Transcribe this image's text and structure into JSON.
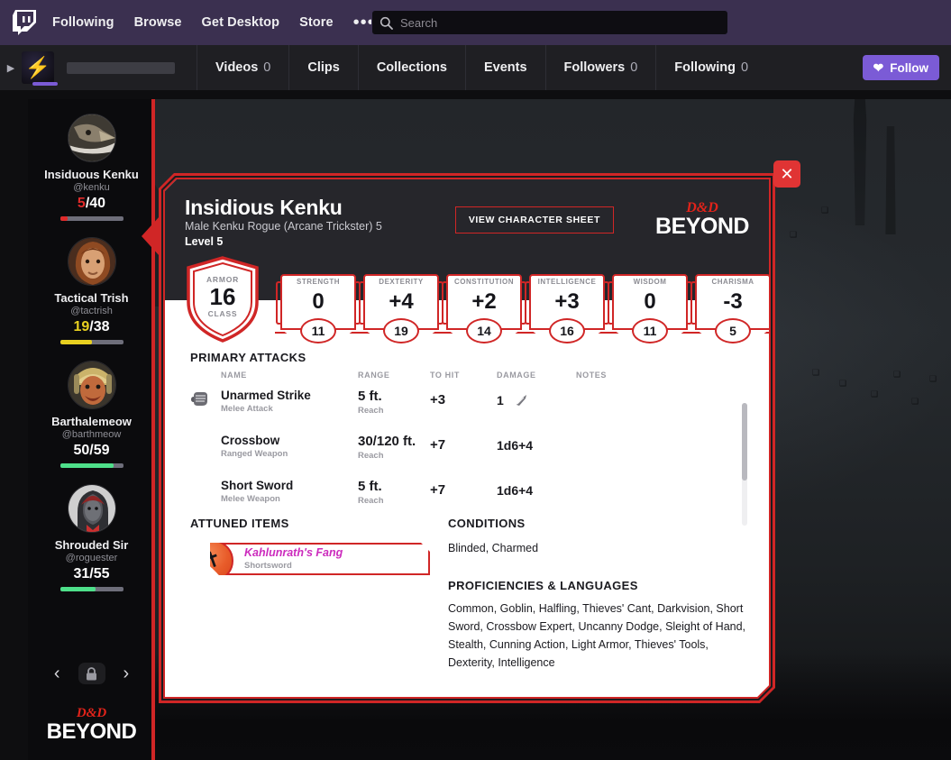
{
  "twitch": {
    "logo_icon": "twitch-logo-icon",
    "nav": [
      {
        "label": "Following"
      },
      {
        "label": "Browse"
      },
      {
        "label": "Get Desktop"
      },
      {
        "label": "Store"
      }
    ],
    "more_label": "•••",
    "search": {
      "icon": "search-icon",
      "value": "",
      "placeholder": "Search"
    },
    "channel": {
      "expand_icon": "chevron-right-icon",
      "avatar_icon": "lightning-bolt-icon",
      "name_placeholder": "",
      "tabs": [
        {
          "label": "Videos",
          "count": "0"
        },
        {
          "label": "Clips",
          "count": ""
        },
        {
          "label": "Collections",
          "count": ""
        },
        {
          "label": "Events",
          "count": ""
        },
        {
          "label": "Followers",
          "count": "0"
        },
        {
          "label": "Following",
          "count": "0"
        }
      ],
      "follow_label": "Follow",
      "follow_icon": "heart-icon",
      "follow_color": "#7b5bd6"
    }
  },
  "party": {
    "members": [
      {
        "name": "Insiduous Kenku",
        "handle": "@kenku",
        "hp_current": "5",
        "hp_max": "40",
        "hp_separator": "/",
        "hp_percent": 12,
        "hp_color": "#e02a2a",
        "avatar_icon": "kenku-portrait-avatar"
      },
      {
        "name": "Tactical Trish",
        "handle": "@tactrish",
        "hp_current": "19",
        "hp_max": "38",
        "hp_separator": "/",
        "hp_percent": 50,
        "hp_color": "#e8d020",
        "avatar_icon": "trish-portrait-avatar"
      },
      {
        "name": "Barthalemeow",
        "handle": "@barthmeow",
        "hp_current": "50",
        "hp_max": "59",
        "hp_separator": "/",
        "hp_percent": 85,
        "hp_color": "#4ee08a",
        "avatar_icon": "barthalemeow-portrait-avatar"
      },
      {
        "name": "Shrouded Sir",
        "handle": "@roguester",
        "hp_current": "31",
        "hp_max": "55",
        "hp_separator": "/",
        "hp_percent": 56,
        "hp_color": "#4ee08a",
        "avatar_icon": "shrouded-sir-portrait-avatar"
      }
    ],
    "prev_label": "‹",
    "next_label": "›",
    "lock_icon": "lock-icon",
    "logo": {
      "line1": "D&D",
      "line2": "BEYOND"
    }
  },
  "card": {
    "close_label": "✕",
    "name": "Insidious Kenku",
    "subtitle": "Male Kenku Rogue (Arcane Trickster) 5",
    "level": "Level 5",
    "view_sheet_label": "VIEW CHARACTER SHEET",
    "logo": {
      "line1": "D&D",
      "line2": "BEYOND"
    },
    "accent_color": "#d02626",
    "armor_class": {
      "label_top": "ARMOR",
      "value": "16",
      "label_bottom": "CLASS"
    },
    "abilities": [
      {
        "name": "STRENGTH",
        "modifier": "0",
        "score": "11"
      },
      {
        "name": "DEXTERITY",
        "modifier": "+4",
        "score": "19"
      },
      {
        "name": "CONSTITUTION",
        "modifier": "+2",
        "score": "14"
      },
      {
        "name": "INTELLIGENCE",
        "modifier": "+3",
        "score": "16"
      },
      {
        "name": "WISDOM",
        "modifier": "0",
        "score": "11"
      },
      {
        "name": "CHARISMA",
        "modifier": "-3",
        "score": "5"
      }
    ],
    "attacks": {
      "title": "PRIMARY ATTACKS",
      "columns": [
        "NAME",
        "RANGE",
        "TO HIT",
        "DAMAGE",
        "NOTES"
      ],
      "rows": [
        {
          "icon": "fist-icon",
          "name": "Unarmed Strike",
          "type": "Melee Attack",
          "range": "5 ft.",
          "range_type": "Reach",
          "to_hit": "+3",
          "damage": "1",
          "damage_icon": "bludgeoning-damage-icon",
          "notes": ""
        },
        {
          "icon": "",
          "name": "Crossbow",
          "type": "Ranged Weapon",
          "range": "30/120 ft.",
          "range_type": "Reach",
          "to_hit": "+7",
          "damage": "1d6+4",
          "damage_icon": "",
          "notes": ""
        },
        {
          "icon": "",
          "name": "Short Sword",
          "type": "Melee Weapon",
          "range": "5 ft.",
          "range_type": "Reach",
          "to_hit": "+7",
          "damage": "1d6+4",
          "damage_icon": "",
          "notes": ""
        }
      ]
    },
    "attuned": {
      "title": "ATTUNED ITEMS",
      "items": [
        {
          "name": "Kahlunrath's Fang",
          "type": "Shortsword",
          "icon": "dagger-icon",
          "name_color": "#cc2bbd"
        }
      ]
    },
    "conditions": {
      "title": "CONDITIONS",
      "text": "Blinded, Charmed"
    },
    "proficiencies": {
      "title": "PROFICIENCIES & LANGUAGES",
      "text": "Common, Goblin, Halfling, Thieves' Cant, Darkvision, Short Sword, Crossbow Expert, Uncanny Dodge, Sleight of Hand, Stealth, Cunning Action, Light Armor, Thieves' Tools, Dexterity, Intelligence"
    }
  }
}
